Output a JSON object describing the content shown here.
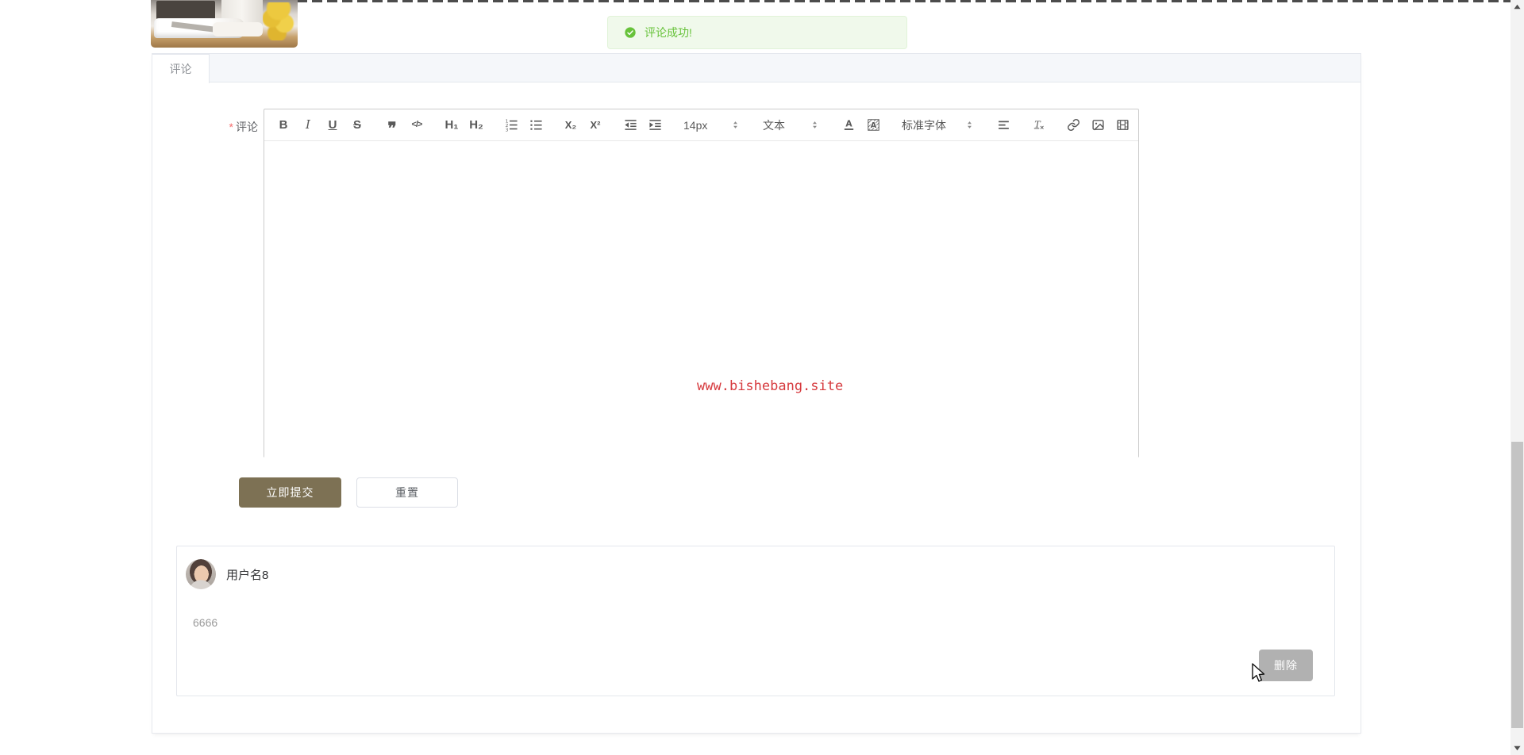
{
  "toast": {
    "text": "评论成功!",
    "bg": "#f0f9eb",
    "color": "#67c23a",
    "icon": "check-circle-icon"
  },
  "tabs": {
    "active_label": "评论"
  },
  "form": {
    "label": "评论",
    "required_mark": "*"
  },
  "editor": {
    "toolbar": {
      "items": [
        {
          "name": "bold-button",
          "kind": "glyph",
          "glyph": "B",
          "cls": "b"
        },
        {
          "name": "italic-button",
          "kind": "glyph",
          "glyph": "I",
          "cls": "i"
        },
        {
          "name": "underline-button",
          "kind": "glyph",
          "glyph": "U",
          "cls": "u"
        },
        {
          "name": "strikethrough-button",
          "kind": "glyph",
          "glyph": "S",
          "cls": "s"
        },
        {
          "name": "blockquote-button",
          "kind": "glyph",
          "glyph": "❞",
          "cls": "quote",
          "gap": true
        },
        {
          "name": "code-button",
          "kind": "glyph",
          "glyph": "</>",
          "cls": "code"
        },
        {
          "name": "header1-button",
          "kind": "glyph",
          "glyph": "H₁",
          "cls": "h",
          "gap": true
        },
        {
          "name": "header2-button",
          "kind": "glyph",
          "glyph": "H₂",
          "cls": "h"
        },
        {
          "name": "ordered-list-button",
          "kind": "svg",
          "icon": "ic-ol",
          "gap": true
        },
        {
          "name": "unordered-list-button",
          "kind": "svg",
          "icon": "ic-ul"
        },
        {
          "name": "subscript-button",
          "kind": "glyph",
          "glyph": "X₂",
          "cls": "sub",
          "gap": true
        },
        {
          "name": "superscript-button",
          "kind": "glyph",
          "glyph": "X²",
          "cls": "sub"
        },
        {
          "name": "indent-decrease-button",
          "kind": "svg",
          "icon": "ic-indent-dec",
          "gap": true
        },
        {
          "name": "indent-increase-button",
          "kind": "svg",
          "icon": "ic-indent-inc"
        },
        {
          "name": "font-size-select",
          "kind": "select",
          "label": "14px",
          "gap": true
        },
        {
          "name": "paragraph-type-select",
          "kind": "select",
          "label": "文本",
          "gap": true
        },
        {
          "name": "font-color-button",
          "kind": "svg",
          "icon": "ic-font-color",
          "gap": true
        },
        {
          "name": "bg-color-button",
          "kind": "svg",
          "icon": "ic-bg-color"
        },
        {
          "name": "font-family-select",
          "kind": "select",
          "label": "标准字体",
          "wide": true,
          "gap": true
        },
        {
          "name": "align-button",
          "kind": "svg",
          "icon": "ic-align",
          "gap": true
        },
        {
          "name": "clear-format-button",
          "kind": "svg",
          "icon": "ic-clear-format",
          "gap": true
        },
        {
          "name": "link-button",
          "kind": "svg",
          "icon": "ic-link",
          "gap": true
        },
        {
          "name": "image-button",
          "kind": "svg",
          "icon": "ic-image"
        },
        {
          "name": "video-button",
          "kind": "svg",
          "icon": "ic-video"
        }
      ]
    },
    "content_text": "www.bishebang.site",
    "content_color": "#d63a3e"
  },
  "buttons": {
    "submit_label": "立即提交",
    "reset_label": "重置"
  },
  "comment": {
    "username": "用户名8",
    "content": "6666",
    "delete_label": "删除"
  },
  "icons": {
    "check-circle-icon": "green circle with white check",
    "caret-updown-icon": "⬍ two stacked triangles",
    "ordered-list-icon": "numbered list lines",
    "unordered-list-icon": "bulleted list lines",
    "indent-decrease-icon": "left arrow with lines",
    "indent-increase-icon": "right arrow with lines",
    "font-color-icon": "A over color bar",
    "bg-color-icon": "A over hatched square",
    "align-icon": "horizontal bars",
    "clear-format-icon": "Tx",
    "link-icon": "chain",
    "image-icon": "picture",
    "video-icon": "film",
    "scroll-up-icon": "▲",
    "scroll-down-icon": "▼",
    "mouse-cursor-icon": "arrow pointer"
  },
  "colors": {
    "accent": "#7d7154",
    "success": "#67c23a",
    "toast_bg": "#f0f9eb",
    "delete_button_bg": "#b1b1b1",
    "watermark_red": "#d63a3e"
  }
}
